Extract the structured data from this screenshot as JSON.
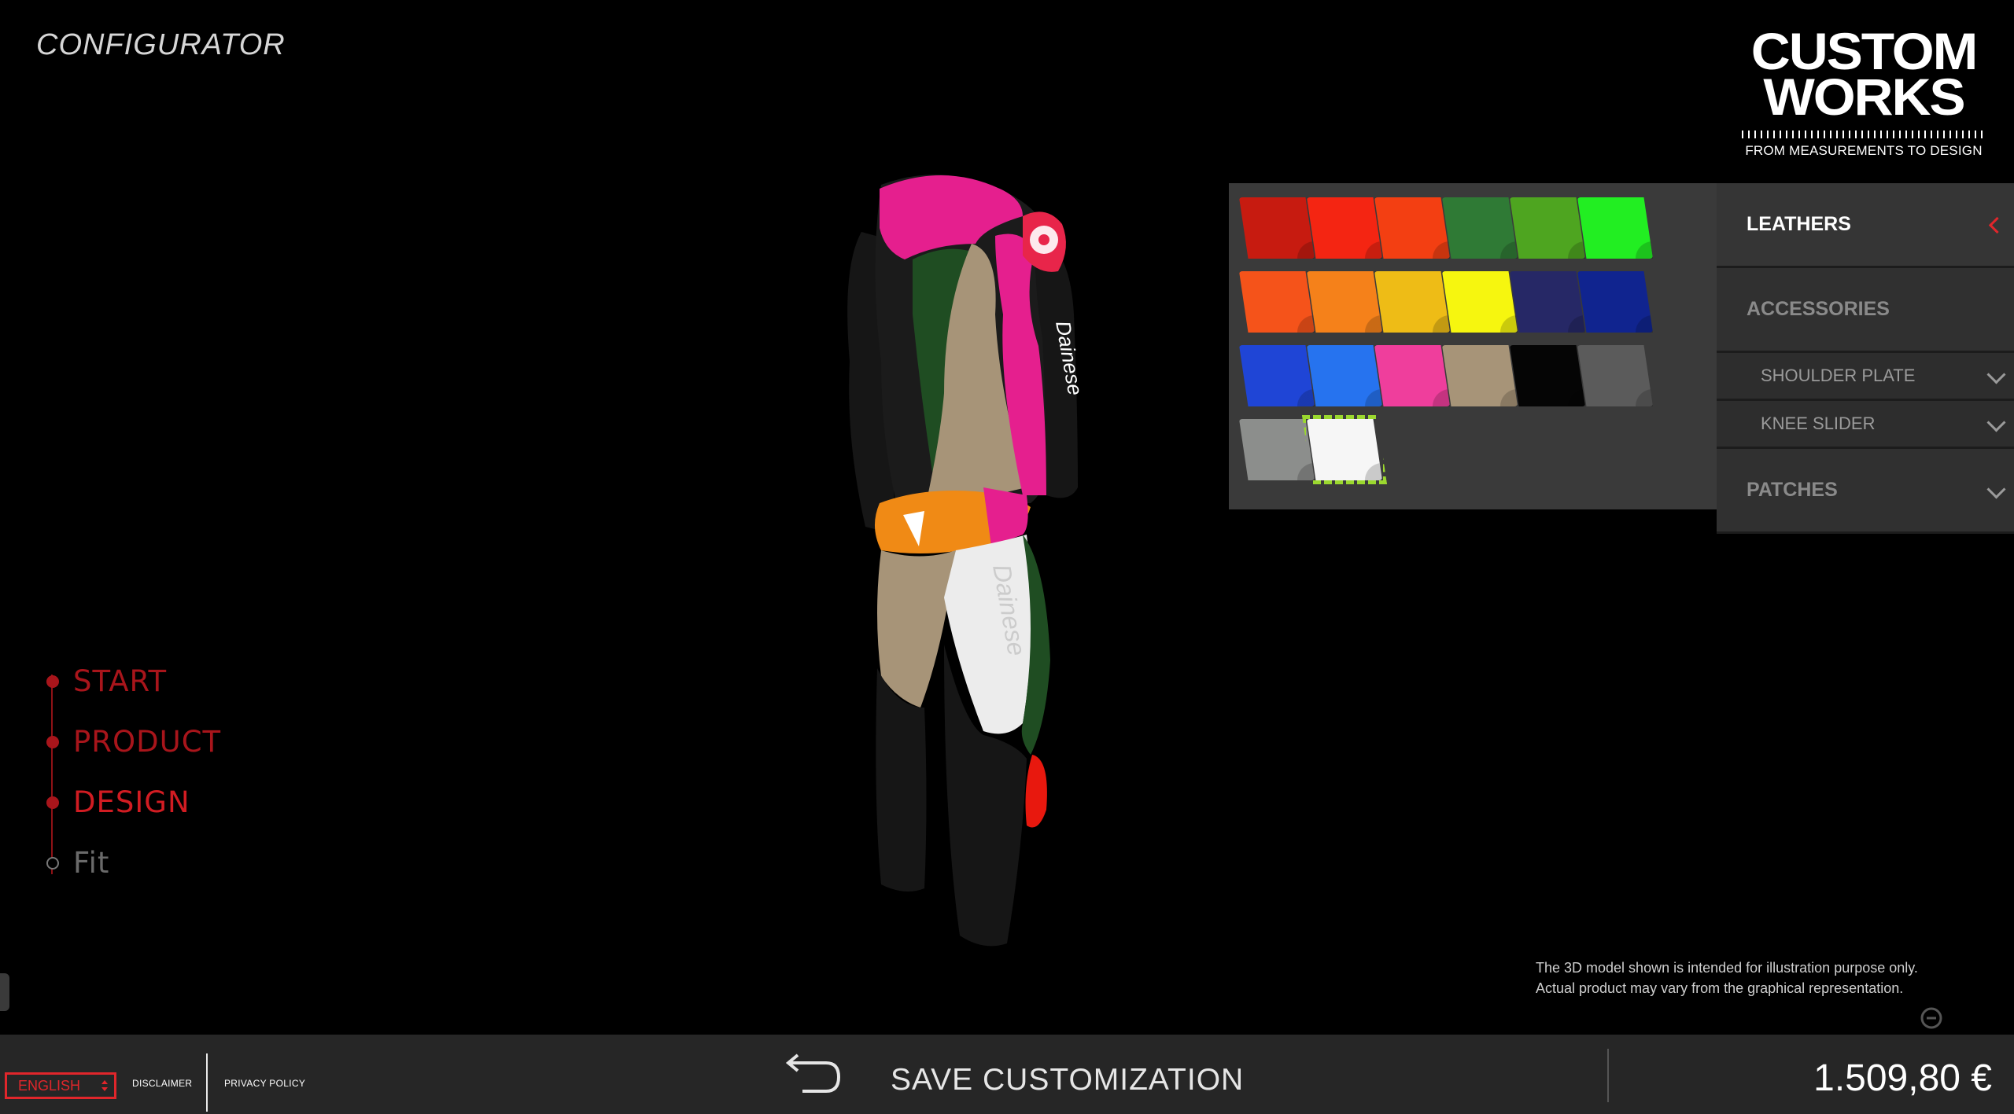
{
  "header": {
    "title": "CONFIGURATOR"
  },
  "logo": {
    "line1": "CUSTOM",
    "line2": "WORKS",
    "tagline": "FROM MEASUREMENTS TO DESIGN"
  },
  "swatches": [
    {
      "color": "#c71b10"
    },
    {
      "color": "#f42512"
    },
    {
      "color": "#f33f12"
    },
    {
      "color": "#2f7a35"
    },
    {
      "color": "#4ea520"
    },
    {
      "color": "#22ee22"
    },
    {
      "color": "#f5531a"
    },
    {
      "color": "#f5811a"
    },
    {
      "color": "#eebc16"
    },
    {
      "color": "#f6f60f"
    },
    {
      "color": "#262866"
    },
    {
      "color": "#10248f"
    },
    {
      "color": "#1f45d6"
    },
    {
      "color": "#2673ef"
    },
    {
      "color": "#ef3e9c"
    },
    {
      "color": "#a79478"
    },
    {
      "color": "#050505"
    },
    {
      "color": "#5b5b5b"
    },
    {
      "color": "#8c8e8c"
    },
    {
      "color": "#f6f6f6"
    }
  ],
  "selected_swatch": "#f6f6f6",
  "menu": {
    "leathers": "LEATHERS",
    "accessories": "ACCESSORIES",
    "shoulder_plate": "SHOULDER PLATE",
    "knee_slider": "KNEE SLIDER",
    "patches": "PATCHES"
  },
  "steps": [
    {
      "label": "START",
      "color": "#a8151b"
    },
    {
      "label": "PRODUCT",
      "color": "#a8151b"
    },
    {
      "label": "DESIGN",
      "color": "#d11c22"
    },
    {
      "label": "Fit",
      "color": "#6a6a6a"
    }
  ],
  "note": {
    "line1": "The 3D model shown is intended for illustration purpose only.",
    "line2": "Actual product may vary from the graphical representation."
  },
  "footer": {
    "language": "ENGLISH",
    "disclaimer": "DISCLAIMER",
    "privacy": "PRIVACY POLICY",
    "save": "SAVE CUSTOMIZATION",
    "price": "1.509,80 €"
  },
  "model": {
    "brand_text": "Dainese"
  },
  "colors": {
    "accent": "#e0262b",
    "selected_outline": "#9bd82f",
    "panel": "#3a3a3a"
  }
}
